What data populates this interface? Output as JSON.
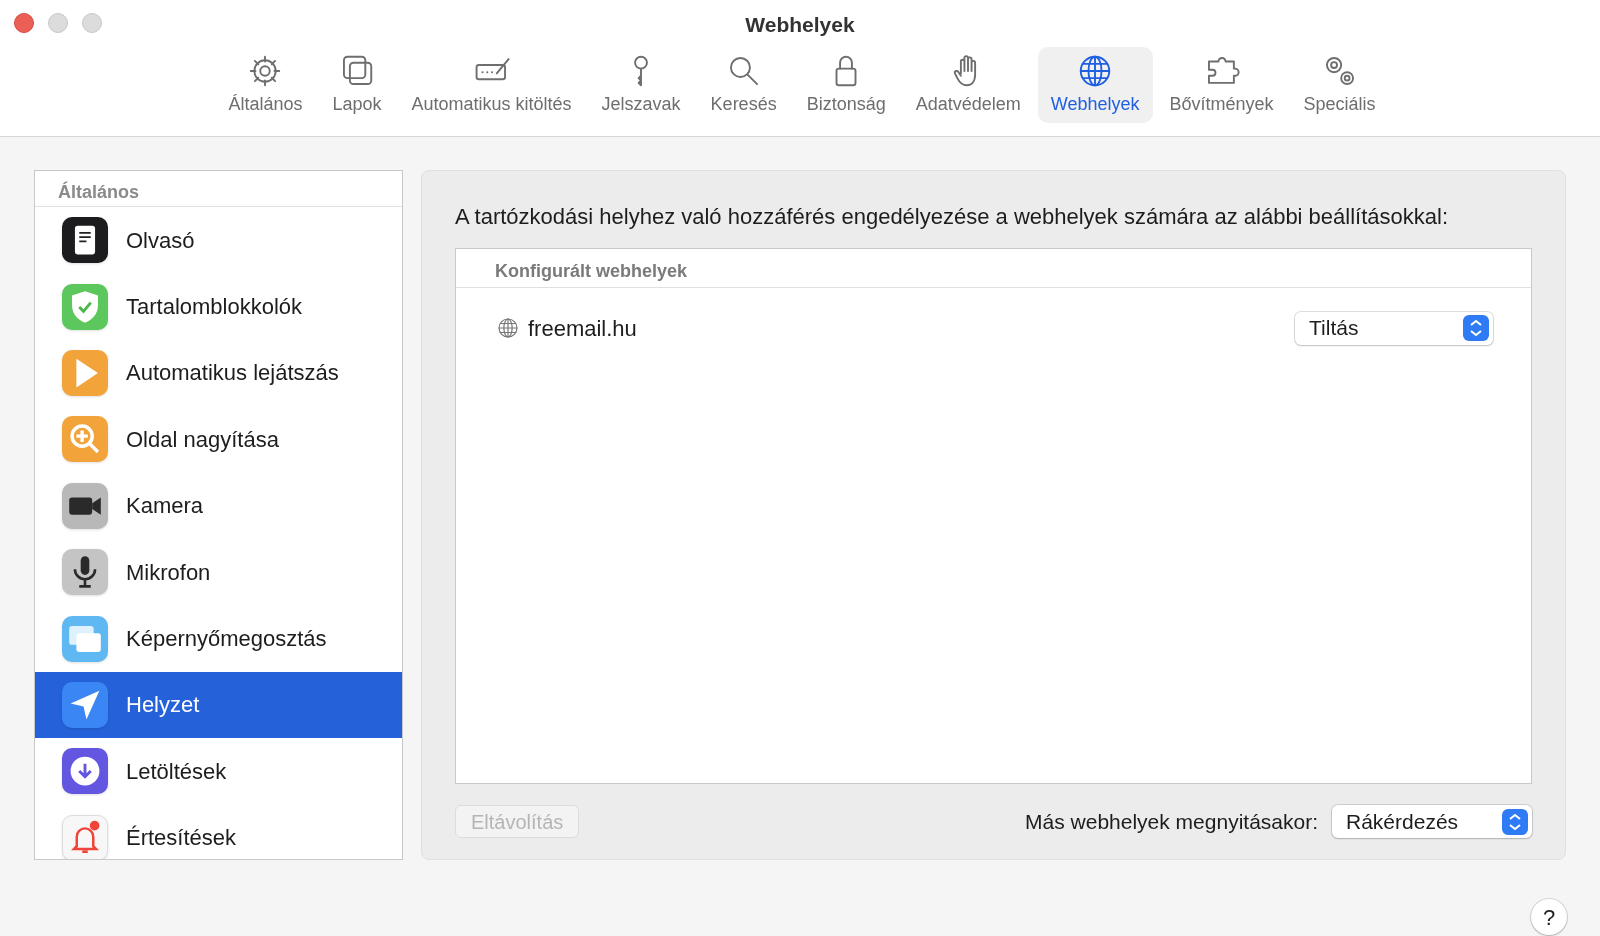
{
  "window": {
    "title": "Webhelyek"
  },
  "toolbar": [
    {
      "label": "Általános",
      "selected": false
    },
    {
      "label": "Lapok",
      "selected": false
    },
    {
      "label": "Automatikus kitöltés",
      "selected": false
    },
    {
      "label": "Jelszavak",
      "selected": false
    },
    {
      "label": "Keresés",
      "selected": false
    },
    {
      "label": "Biztonság",
      "selected": false
    },
    {
      "label": "Adatvédelem",
      "selected": false
    },
    {
      "label": "Webhelyek",
      "selected": true
    },
    {
      "label": "Bővítmények",
      "selected": false
    },
    {
      "label": "Speciális",
      "selected": false
    }
  ],
  "sidebar": {
    "header": "Általános",
    "items": [
      {
        "label": "Olvasó",
        "selected": false
      },
      {
        "label": "Tartalomblokkolók",
        "selected": false
      },
      {
        "label": "Automatikus lejátszás",
        "selected": false
      },
      {
        "label": "Oldal nagyítása",
        "selected": false
      },
      {
        "label": "Kamera",
        "selected": false
      },
      {
        "label": "Mikrofon",
        "selected": false
      },
      {
        "label": "Képernyőmegosztás",
        "selected": false
      },
      {
        "label": "Helyzet",
        "selected": true
      },
      {
        "label": "Letöltések",
        "selected": false
      },
      {
        "label": "Értesítések",
        "selected": false
      }
    ]
  },
  "content": {
    "heading": "A tartózkodási helyhez való hozzáférés engedélyezése a webhelyek számára az alábbi beállításokkal:",
    "table": {
      "header": "Konfigurált webhelyek",
      "rows": [
        {
          "site": "freemail.hu",
          "setting": "Tiltás"
        }
      ]
    },
    "remove_button": {
      "label": "Eltávolítás",
      "disabled": true
    },
    "other_label": "Más webhelyek megnyitásakor:",
    "other_value": "Rákérdezés"
  },
  "help": "?"
}
